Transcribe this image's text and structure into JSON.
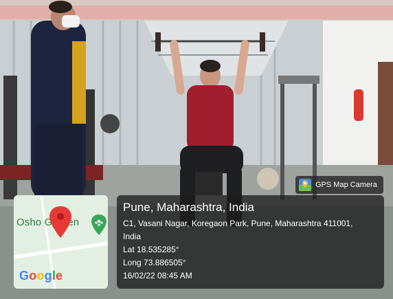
{
  "badge": {
    "label": "GPS Map Camera"
  },
  "map": {
    "place_name": "Osho Garden",
    "brand": "Google",
    "brand_letters": [
      "G",
      "o",
      "o",
      "g",
      "l",
      "e"
    ],
    "brand_colors": [
      "#4285f4",
      "#ea4335",
      "#fbbc05",
      "#4285f4",
      "#34a853",
      "#ea4335"
    ],
    "pin_color": "#e53935",
    "poi_color": "#3aa757"
  },
  "location": {
    "title": "Pune, Maharashtra, India",
    "address_line1": "C1, Vasani Nagar, Koregaon Park, Pune, Maharashtra 411001,",
    "address_line2": "India",
    "lat": "Lat 18.535285°",
    "long": "Long 73.886505°",
    "datetime": "16/02/22 08:45 AM"
  }
}
